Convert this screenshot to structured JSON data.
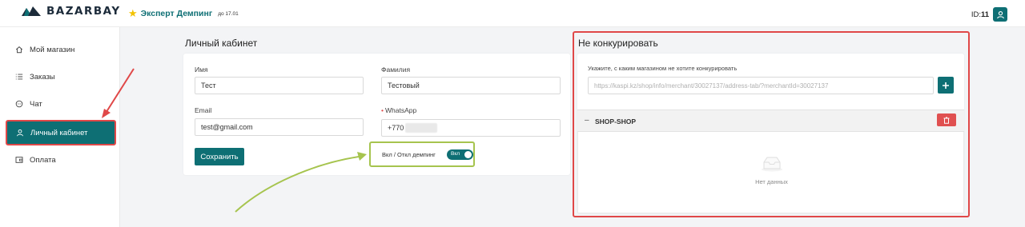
{
  "header": {
    "logo_text": "BAZARBAY",
    "promo_title": "Эксперт Демпинг",
    "promo_until": "до 17.01",
    "id_label": "ID:",
    "id_value": "11"
  },
  "sidebar": {
    "items": [
      {
        "label": "Мой магазин",
        "icon": "home-icon"
      },
      {
        "label": "Заказы",
        "icon": "list-icon"
      },
      {
        "label": "Чат",
        "icon": "chat-icon"
      },
      {
        "label": "Личный кабинет",
        "icon": "user-icon",
        "active": true
      },
      {
        "label": "Оплата",
        "icon": "wallet-icon"
      }
    ]
  },
  "profile": {
    "title": "Личный кабинет",
    "first_name_label": "Имя",
    "first_name_value": "Тест",
    "last_name_label": "Фамилия",
    "last_name_value": "Тестовый",
    "email_label": "Email",
    "email_value": "test@gmail.com",
    "whatsapp_label": "WhatsApp",
    "whatsapp_value": "+770",
    "save_label": "Сохранить",
    "dumping_toggle_label": "Вкл / Откл демпинг",
    "dumping_toggle_state": "Вкл"
  },
  "no_compete": {
    "title": "Не конкурировать",
    "instruction": "Укажите, с каким магазином не хотите конкурировать",
    "input_placeholder": "https://kaspi.kz/shop/info/merchant/30027137/address-tab/?merchantId=30027137",
    "shop_name": "SHOP-SHOP",
    "empty_text": "Нет данных"
  },
  "colors": {
    "brand": "#0e6f74",
    "highlight_red": "#e04848",
    "highlight_green": "#a6c44e",
    "star": "#f2c200"
  }
}
